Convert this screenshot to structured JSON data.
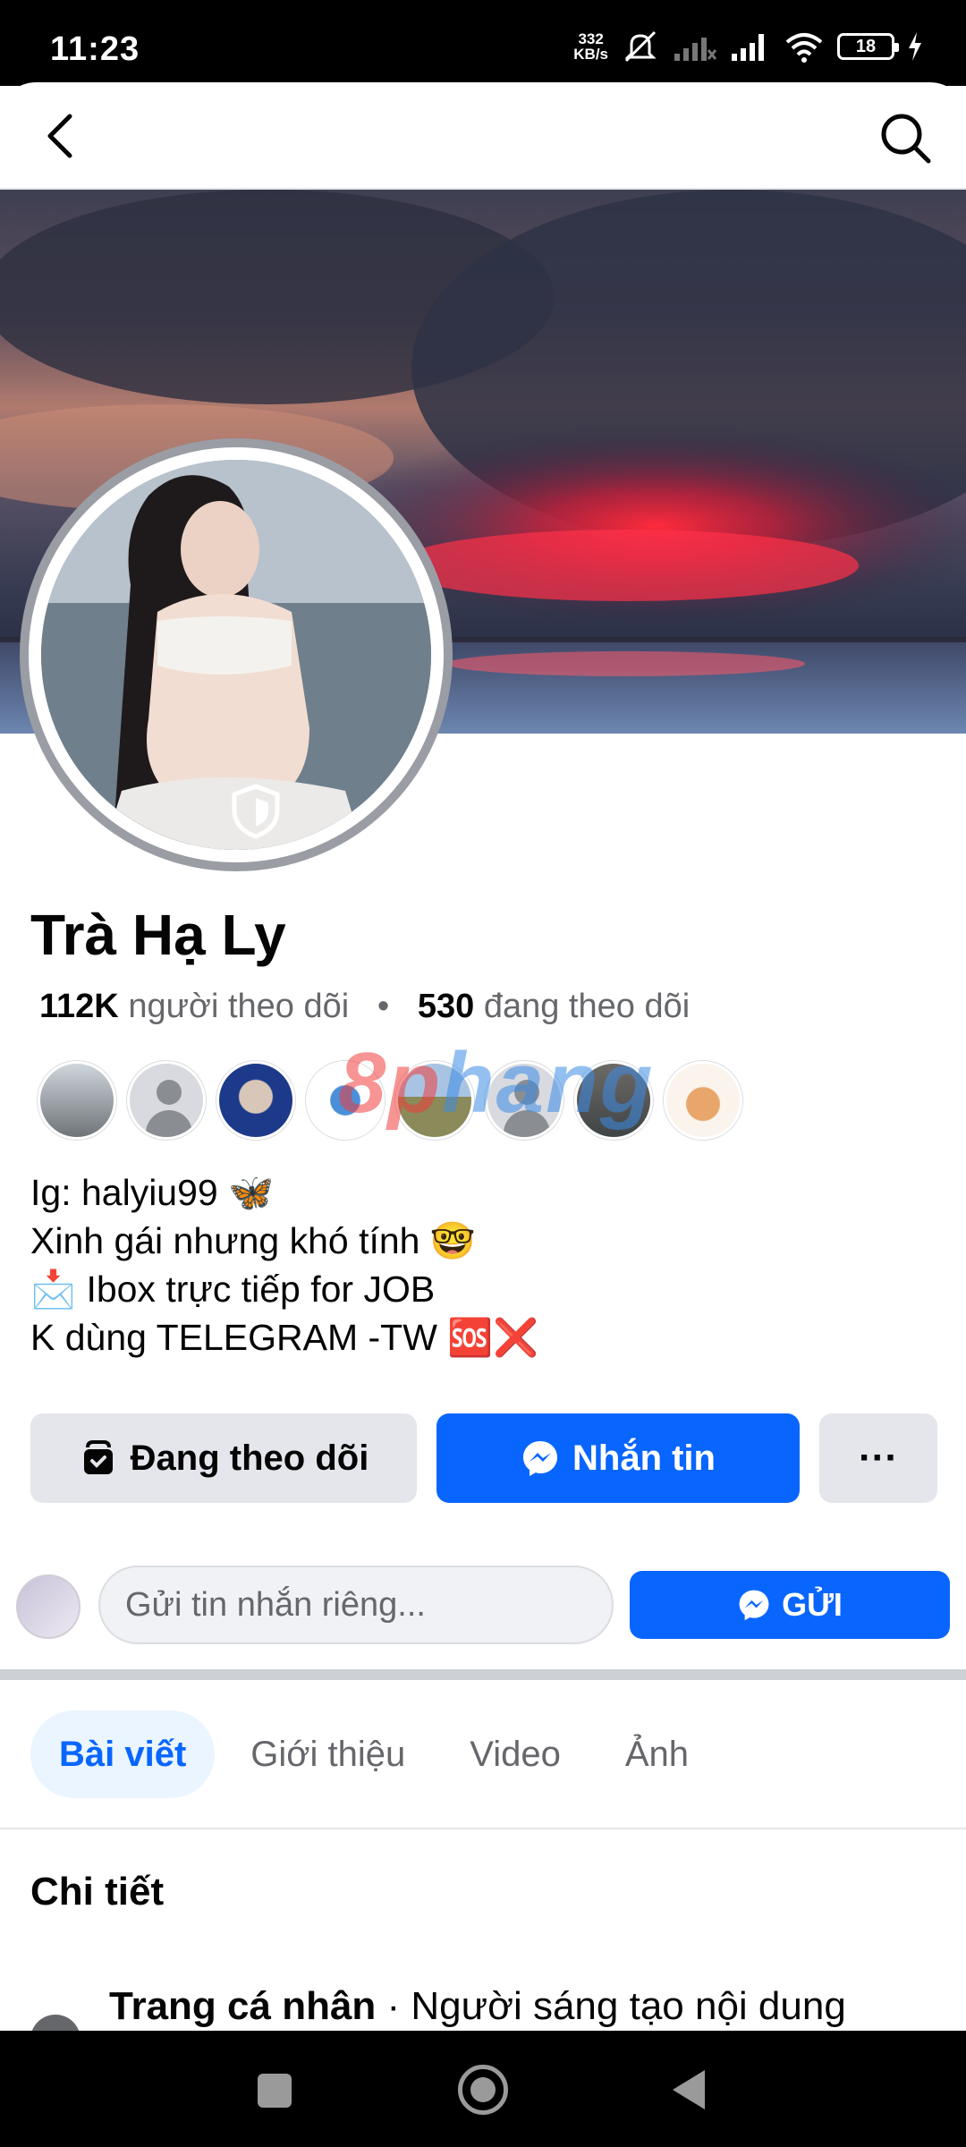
{
  "status_bar": {
    "time": "11:23",
    "net_speed_value": "332",
    "net_speed_unit": "KB/s",
    "battery_level": "18"
  },
  "profile": {
    "name": "Trà Hạ Ly",
    "followers_count": "112K",
    "followers_label": "người theo dõi",
    "separator": "•",
    "following_count": "530",
    "following_label": "đang theo dõi"
  },
  "bio": {
    "line1": "Ig: halyiu99 🦋",
    "line2": "Xinh gái nhưng khó tính 🤓",
    "line3": "📩 Ibox trực tiếp for JOB",
    "line4": "K dùng TELEGRAM -TW 🆘❌"
  },
  "watermark": {
    "part1": "8p",
    "part2": "hang"
  },
  "actions": {
    "following_label": "Đang theo dõi",
    "message_label": "Nhắn tin",
    "more_label": "···"
  },
  "private_message": {
    "placeholder": "Gửi tin nhắn riêng...",
    "send_label": "GỬI"
  },
  "tabs": [
    {
      "label": "Bài viết",
      "active": true
    },
    {
      "label": "Giới thiệu",
      "active": false
    },
    {
      "label": "Video",
      "active": false
    },
    {
      "label": "Ảnh",
      "active": false
    }
  ],
  "details": {
    "title": "Chi tiết",
    "row_bold": "Trang cá nhân",
    "row_rest": " · Người sáng tạo nội dung"
  },
  "colors": {
    "accent": "#0866ff",
    "button_grey": "#e4e6eb"
  },
  "icons": [
    "back-icon",
    "search-icon",
    "shield-icon",
    "bookmark-icon",
    "messenger-icon",
    "more-icon"
  ]
}
